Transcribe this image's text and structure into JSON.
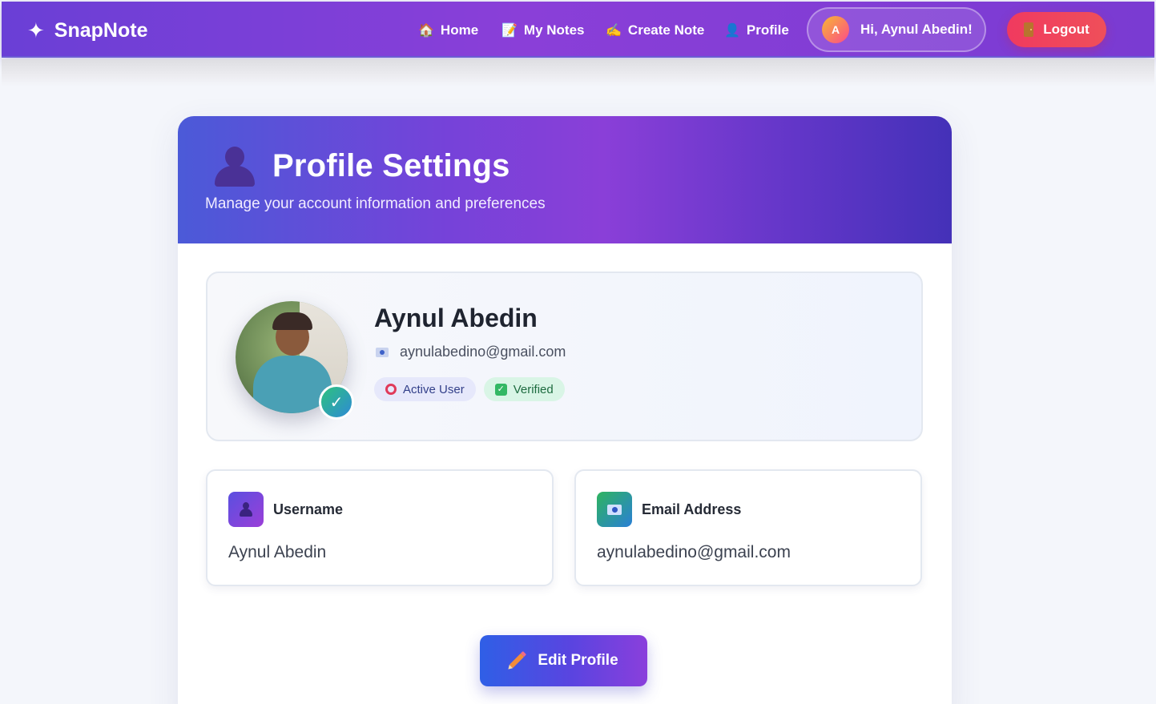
{
  "navbar": {
    "brand": "SnapNote",
    "brand_icon": "sparkles-icon",
    "links": [
      {
        "label": "Home",
        "icon": "house-icon",
        "emoji": "🏠"
      },
      {
        "label": "My Notes",
        "icon": "note-icon",
        "emoji": "📝"
      },
      {
        "label": "Create Note",
        "icon": "writing-hand-icon",
        "emoji": "✍️"
      },
      {
        "label": "Profile",
        "icon": "user-icon",
        "emoji": "👤"
      }
    ],
    "user_initial": "A",
    "greeting": "Hi, Aynul Abedin!",
    "logout_label": "Logout"
  },
  "header": {
    "title": "Profile Settings",
    "subtitle": "Manage your account information and preferences"
  },
  "summary": {
    "name": "Aynul Abedin",
    "email": "aynulabedino@gmail.com",
    "verified_mark": "✓",
    "badges": [
      {
        "label": "Active User"
      },
      {
        "label": "Verified"
      }
    ]
  },
  "fields": {
    "username": {
      "label": "Username",
      "value": "Aynul Abedin"
    },
    "email": {
      "label": "Email Address",
      "value": "aynulabedino@gmail.com"
    }
  },
  "actions": {
    "edit_label": "Edit Profile"
  },
  "colors": {
    "primary": "#7a3fd6",
    "logout": "#f03a5f",
    "verified": "#2ec27e"
  }
}
